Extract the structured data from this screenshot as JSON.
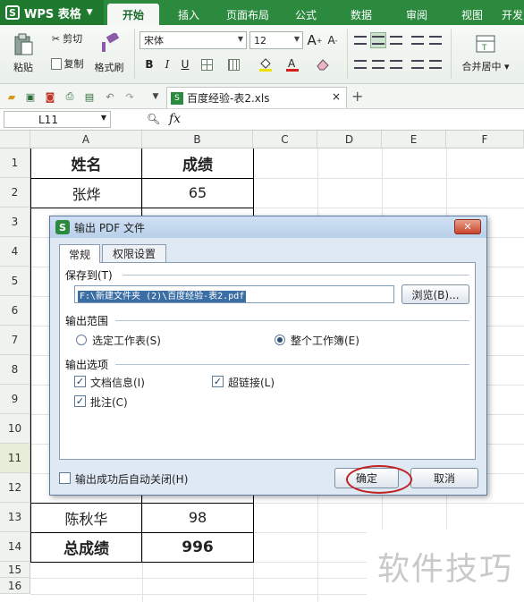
{
  "app": {
    "brand": "WPS 表格",
    "logo_glyph": "S"
  },
  "tabs": [
    "开始",
    "插入",
    "页面布局",
    "公式",
    "数据",
    "审阅",
    "视图",
    "开发"
  ],
  "ribbon": {
    "paste": "粘贴",
    "cut": "剪切",
    "copy": "复制",
    "format_painter": "格式刷",
    "font_name": "宋体",
    "font_size": "12",
    "grow_font": "A",
    "shrink_font": "A",
    "bold": "B",
    "italic": "I",
    "underline": "U",
    "merge_center": "合并居中"
  },
  "doc_tab": {
    "title": "百度经验-表2.xls",
    "close": "×",
    "new_tab": "+"
  },
  "formula_bar": {
    "cell_ref": "L11",
    "fx": "fx"
  },
  "grid": {
    "columns": [
      "A",
      "B",
      "C",
      "D",
      "E",
      "F"
    ],
    "rows": [
      "1",
      "2",
      "3",
      "4",
      "5",
      "6",
      "7",
      "8",
      "9",
      "10",
      "11",
      "12",
      "13",
      "14",
      "15",
      "16"
    ],
    "selected_row": "11",
    "cells": {
      "a1": "姓名",
      "b1": "成绩",
      "a2": "张烨",
      "b2": "65",
      "a13": "陈秋华",
      "b13": "98",
      "a14": "总成绩",
      "b14": "996"
    }
  },
  "dialog": {
    "title": "输出 PDF 文件",
    "close": "✕",
    "tabs": [
      "常规",
      "权限设置"
    ],
    "save_to_label": "保存到(T)",
    "path": "F:\\新建文件夹 (2)\\百度经验-表2.pdf",
    "browse": "浏览(B)...",
    "range_label": "输出范围",
    "range_selected_sheet": "选定工作表(S)",
    "range_whole_book": "整个工作簿(E)",
    "options_label": "输出选项",
    "opt_doc_info": "文档信息(I)",
    "opt_hyperlink": "超链接(L)",
    "opt_comment": "批注(C)",
    "auto_close": "输出成功后自动关闭(H)",
    "ok": "确定",
    "cancel": "取消"
  },
  "watermark": "软件技巧"
}
